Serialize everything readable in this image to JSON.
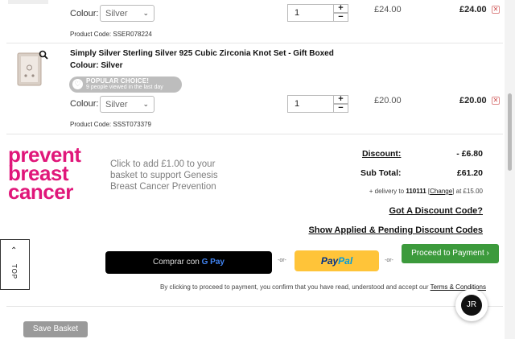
{
  "items": [
    {
      "colour_label": "Colour:",
      "colour_value": "Silver",
      "quantity": "1",
      "unit_price": "£24.00",
      "total_price": "£24.00",
      "product_code": "Product Code: SSER078224"
    },
    {
      "title": "Simply Silver Sterling Silver 925 Cubic Zirconia Knot Set - Gift Boxed",
      "colour_heading": "Colour: Silver",
      "popular_label": "POPULAR CHOICE!",
      "popular_views": "9 people viewed in the last day",
      "colour_label": "Colour:",
      "colour_value": "Silver",
      "quantity": "1",
      "unit_price": "£20.00",
      "total_price": "£20.00",
      "product_code": "Product Code: SSST073379"
    }
  ],
  "donation": {
    "logo_lines": [
      "prevent",
      "breast",
      "cancer"
    ],
    "text": "Click to add £1.00 to your basket to support Genesis Breast Cancer Prevention"
  },
  "summary": {
    "discount_label": "Discount:",
    "discount_value": "- £6.80",
    "subtotal_label": "Sub Total:",
    "subtotal_value": "£61.20",
    "delivery_prefix": "+ delivery to",
    "delivery_postcode": "110111",
    "delivery_change": "Change",
    "delivery_suffix": "at £15.00",
    "discount_code_link": "Got A Discount Code?",
    "applied_codes_link": "Show Applied & Pending Discount Codes"
  },
  "payment": {
    "gpay_text": "Comprar con",
    "gpay_brand": "G Pay",
    "or_text": "-or-",
    "paypal_p1": "Pay",
    "paypal_p2": "Pal",
    "proceed_label": "Proceed to Payment ›",
    "consent_text": "By clicking to proceed to payment, you confirm that you have read, understood and accept our",
    "terms_link": "Terms & Conditions"
  },
  "save_basket": "Save Basket",
  "to_top": "TOP",
  "jr_logo": "JR",
  "colors": {
    "brand_pink": "#e0177a",
    "proceed_green": "#3c9a3c",
    "paypal_yellow": "#ffc439"
  }
}
